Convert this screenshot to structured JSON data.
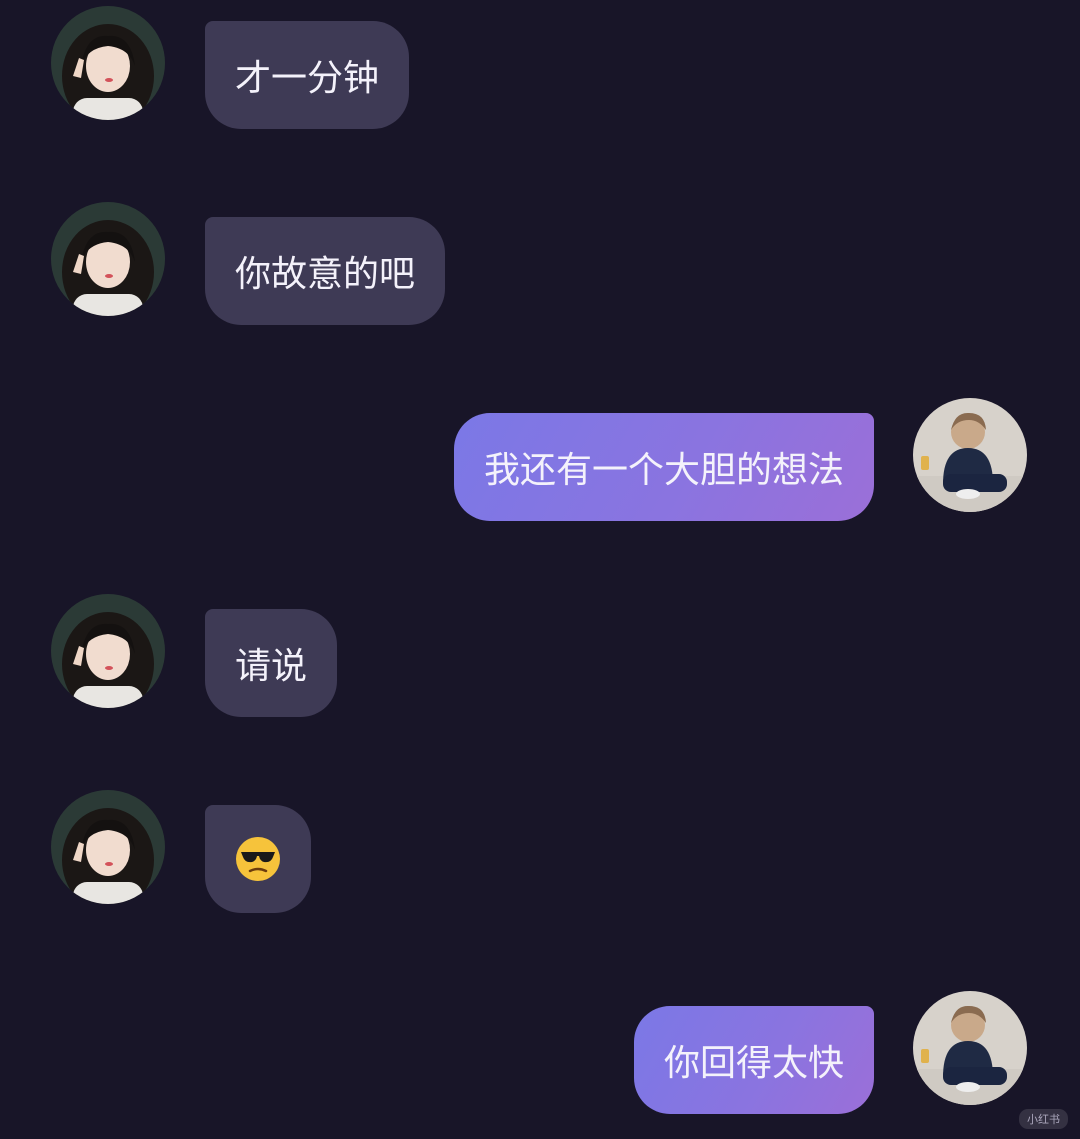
{
  "theme": {
    "background": "#181528",
    "incoming_bubble": "#3e3a55",
    "outgoing_gradient": [
      "#7b78e6",
      "#9b6fd8"
    ],
    "text_color": "#f4f2fb"
  },
  "messages": [
    {
      "side": "incoming",
      "avatar": "girl-avatar",
      "text": "才一分钟"
    },
    {
      "side": "incoming",
      "avatar": "girl-avatar",
      "text": "你故意的吧"
    },
    {
      "side": "outgoing",
      "avatar": "boy-avatar",
      "text": "我还有一个大胆的想法"
    },
    {
      "side": "incoming",
      "avatar": "girl-avatar",
      "text": "请说"
    },
    {
      "side": "incoming",
      "avatar": "girl-avatar",
      "emoji": "sunglasses-emoji"
    },
    {
      "side": "outgoing",
      "avatar": "boy-avatar",
      "text": "你回得太快"
    }
  ],
  "watermark": "小红书"
}
